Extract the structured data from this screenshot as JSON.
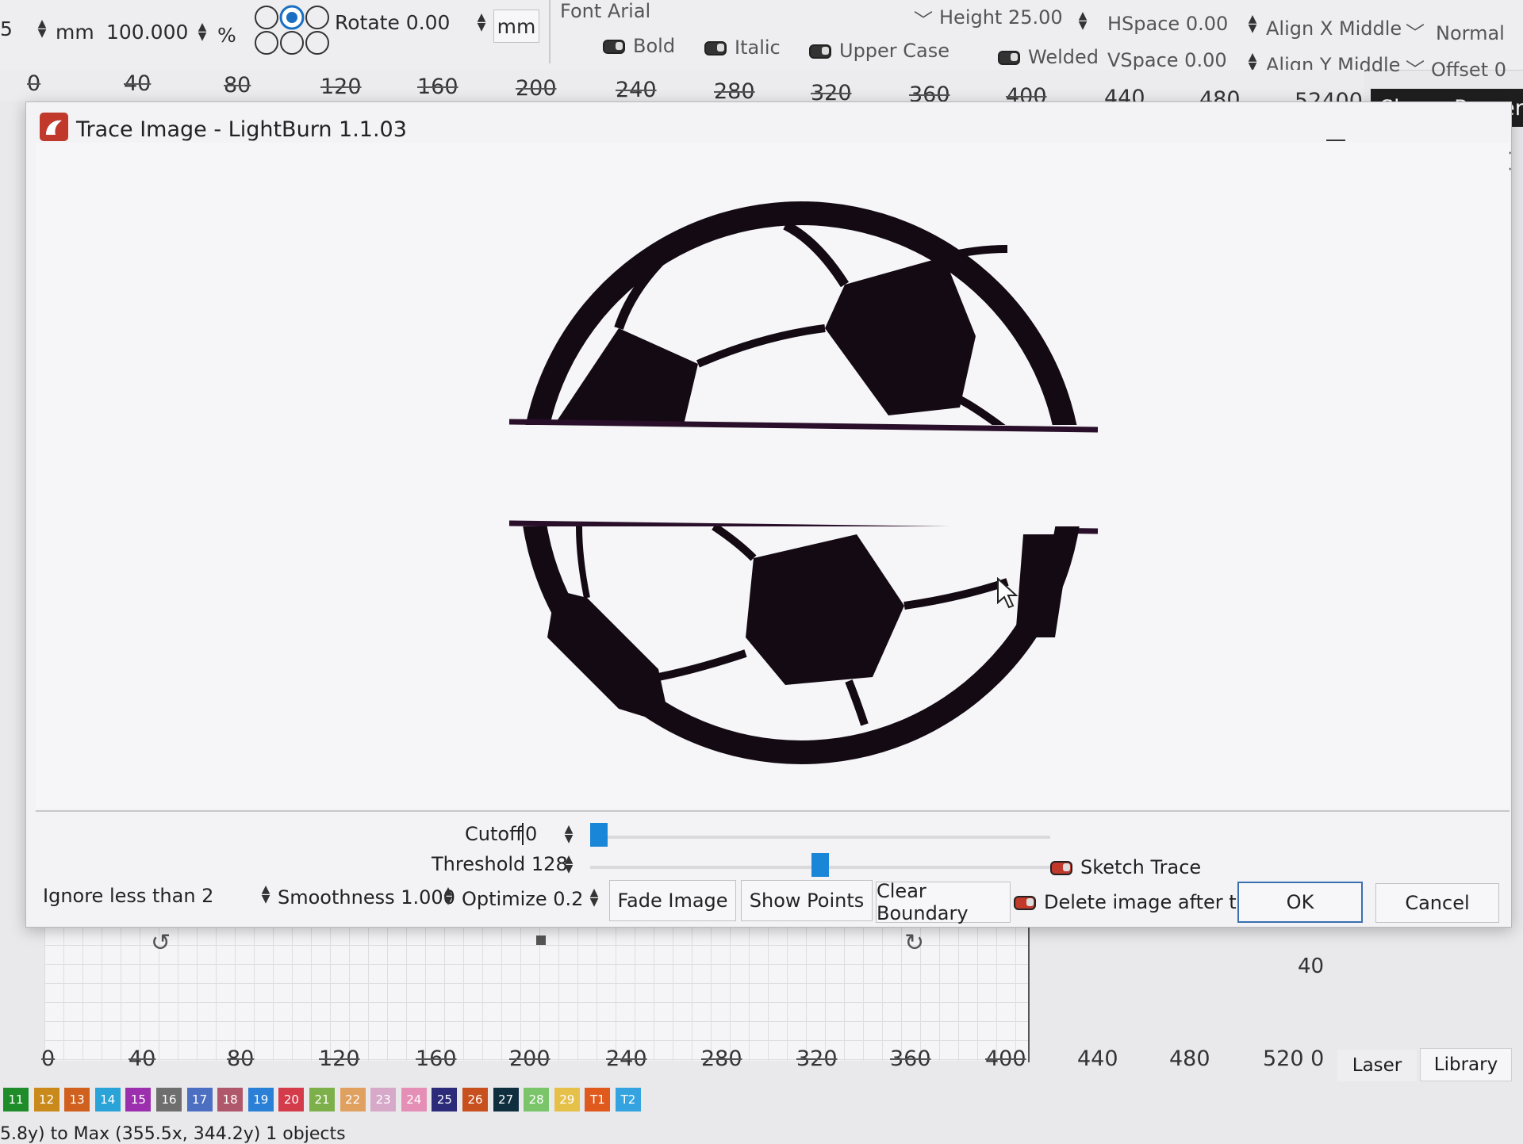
{
  "toolbar": {
    "left_num": "5",
    "unit_mm": "mm",
    "scale_value": "100.000",
    "scale_unit": "%",
    "rotate": "Rotate 0.00",
    "rotate_unit": "mm",
    "font": "Font Arial",
    "bold": "Bold",
    "italic": "Italic",
    "upper_case": "Upper Case",
    "welded": "Welded",
    "height": "Height 25.00",
    "hspace": "HSpace 0.00",
    "vspace": "VSpace 0.00",
    "align_x": "Align X Middle",
    "align_y": "Align Y Middle",
    "normal": "Normal",
    "offset": "Offset 0"
  },
  "top_ruler": [
    "0",
    "40",
    "80",
    "120",
    "160",
    "200",
    "240",
    "280",
    "320",
    "360",
    "400",
    "440",
    "480",
    "52400"
  ],
  "shape_properties": "Shape Propertie",
  "dialog": {
    "title": "Trace Image - LightBurn 1.1.03",
    "cutoff_label": "Cutoff",
    "cutoff_value": "0",
    "threshold": "Threshold 128",
    "threshold_level": 0.5,
    "cutoff_level": 0.0,
    "ignore": "Ignore less than 2",
    "smoothness": "Smoothness 1.000",
    "optimize": "Optimize 0.2",
    "fade_image": "Fade Image",
    "show_points": "Show Points",
    "clear_boundary": "Clear Boundary",
    "delete_after": "Delete image after trace",
    "sketch_trace": "Sketch Trace",
    "ok": "OK",
    "cancel": "Cancel"
  },
  "bottom_ruler": [
    "0",
    "40",
    "80",
    "120",
    "160",
    "200",
    "240",
    "280",
    "320",
    "360",
    "400",
    "440",
    "480",
    "520 0"
  ],
  "side_value": "40",
  "tabs": {
    "laser": "Laser",
    "library": "Library"
  },
  "palette": [
    {
      "label": "11",
      "color": "#1f8c2a"
    },
    {
      "label": "12",
      "color": "#c98a1b"
    },
    {
      "label": "13",
      "color": "#d0601e"
    },
    {
      "label": "14",
      "color": "#2aa4d8"
    },
    {
      "label": "15",
      "color": "#9b2fae"
    },
    {
      "label": "16",
      "color": "#6e6e6e"
    },
    {
      "label": "17",
      "color": "#4d6fc2"
    },
    {
      "label": "18",
      "color": "#b0586b"
    },
    {
      "label": "19",
      "color": "#2a7fd6"
    },
    {
      "label": "20",
      "color": "#d43b4b"
    },
    {
      "label": "21",
      "color": "#7db04a"
    },
    {
      "label": "22",
      "color": "#e0a060"
    },
    {
      "label": "23",
      "color": "#d7a9c9"
    },
    {
      "label": "24",
      "color": "#e58fb6"
    },
    {
      "label": "25",
      "color": "#2b2b7a"
    },
    {
      "label": "26",
      "color": "#c8501f"
    },
    {
      "label": "27",
      "color": "#0f2f3f"
    },
    {
      "label": "28",
      "color": "#7ac46a"
    },
    {
      "label": "29",
      "color": "#e6c14a"
    },
    {
      "label": "T1",
      "color": "#e05a1e"
    },
    {
      "label": "T2",
      "color": "#34a3e0"
    }
  ],
  "status": "5.8y) to Max (355.5x, 344.2y)   1 objects"
}
